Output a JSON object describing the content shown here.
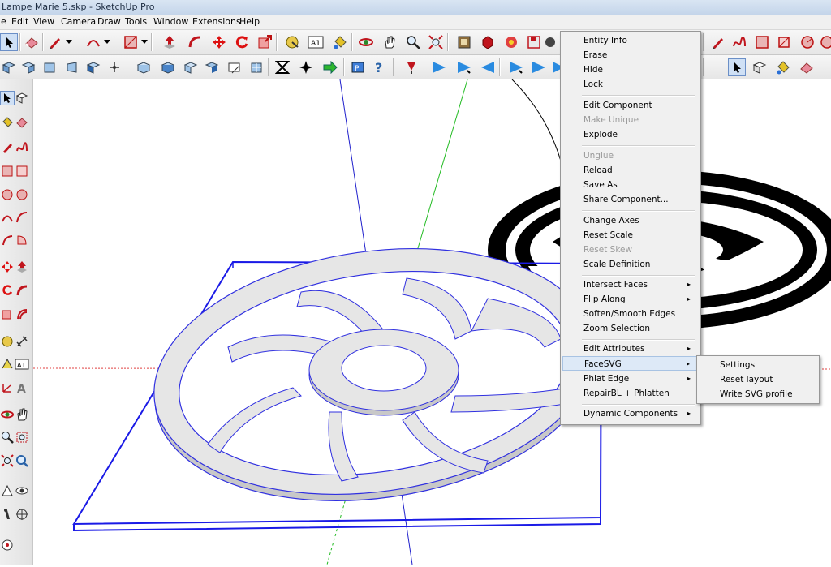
{
  "app": {
    "title": "Lampe Marie 5.skp - SketchUp Pro"
  },
  "menubar": {
    "items": [
      "e",
      "Edit",
      "View",
      "Camera",
      "Draw",
      "Tools",
      "Window",
      "Extensions",
      "Help"
    ]
  },
  "context_menu": {
    "items": [
      {
        "label": "Entity Info",
        "enabled": true
      },
      {
        "label": "Erase",
        "enabled": true
      },
      {
        "label": "Hide",
        "enabled": true
      },
      {
        "label": "Lock",
        "enabled": true
      },
      {
        "label": "Edit Component",
        "enabled": true
      },
      {
        "label": "Make Unique",
        "enabled": false
      },
      {
        "label": "Explode",
        "enabled": true
      },
      {
        "label": "Unglue",
        "enabled": false
      },
      {
        "label": "Reload",
        "enabled": true
      },
      {
        "label": "Save As",
        "enabled": true
      },
      {
        "label": "Share Component...",
        "enabled": true
      },
      {
        "label": "Change Axes",
        "enabled": true
      },
      {
        "label": "Reset Scale",
        "enabled": true
      },
      {
        "label": "Reset Skew",
        "enabled": false
      },
      {
        "label": "Scale Definition",
        "enabled": true
      },
      {
        "label": "Intersect Faces",
        "enabled": true,
        "submenu": true
      },
      {
        "label": "Flip Along",
        "enabled": true,
        "submenu": true
      },
      {
        "label": "Soften/Smooth Edges",
        "enabled": true
      },
      {
        "label": "Zoom Selection",
        "enabled": true
      },
      {
        "label": "Edit Attributes",
        "enabled": true,
        "submenu": true
      },
      {
        "label": "FaceSVG",
        "enabled": true,
        "submenu": true,
        "highlighted": true
      },
      {
        "label": "Phlat Edge",
        "enabled": true,
        "submenu": true
      },
      {
        "label": "RepairBL + Phlatten",
        "enabled": true
      },
      {
        "label": "Dynamic Components",
        "enabled": true,
        "submenu": true
      }
    ],
    "submenu_arrow": "▸"
  },
  "facesvg_submenu": {
    "items": [
      "Settings",
      "Reset layout",
      "Write SVG profile"
    ]
  },
  "toolbar_icons": {
    "row1": [
      "select-arrow-icon",
      "eraser-icon",
      "pencil-icon",
      "arc-icon",
      "rectangle-icon",
      "push-pull-icon",
      "move-icon",
      "rotate-icon",
      "scale-icon",
      "offset-icon",
      "tape-measure-icon",
      "text-icon",
      "paint-bucket-icon",
      "orbit-icon",
      "pan-icon",
      "zoom-icon",
      "zoom-extents-icon",
      "warehouse-icon",
      "components-icon",
      "extension-icon",
      "save-icon"
    ],
    "row2": [
      "iso-view-icon",
      "top-view-icon",
      "front-view-icon",
      "right-view-icon",
      "back-view-icon",
      "left-view-icon",
      "xray-icon",
      "wireframe-icon",
      "hidden-line-icon",
      "shaded-icon",
      "textured-icon",
      "monochrome-icon",
      "solid-union-icon",
      "intersect-icon",
      "follow-me-icon",
      "phlat-icon",
      "help-icon",
      "section-icon",
      "flip-icon"
    ]
  },
  "colors": {
    "selection_blue": "#1a1ae6",
    "axis_red": "#e04040",
    "axis_green": "#22bb22",
    "axis_blue": "#2020cc",
    "face_gray": "#e6e6e6",
    "menu_highlight": "#dde9f7"
  }
}
